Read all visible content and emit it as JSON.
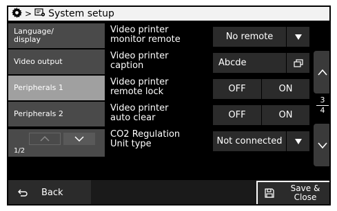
{
  "titlebar": {
    "gear_icon": "gear-icon",
    "separator": ">",
    "crumb_icon": "system-setup-icon",
    "title": "System setup"
  },
  "sidebar": {
    "items": [
      {
        "label": "Language/ display",
        "active": false
      },
      {
        "label": "Video output",
        "active": false
      },
      {
        "label": "Peripherals 1",
        "active": true
      },
      {
        "label": "Peripherals 2",
        "active": false
      }
    ],
    "pager": {
      "page": "1/2"
    }
  },
  "rows": [
    {
      "label_1": "Video printer",
      "label_2": "monitor remote",
      "type": "dropdown",
      "value": "No remote"
    },
    {
      "label_1": "Video printer",
      "label_2": "caption",
      "type": "text",
      "value": "Abcde",
      "icon": "window-icon"
    },
    {
      "label_1": "Video printer",
      "label_2": "remote lock",
      "type": "toggle",
      "off": "OFF",
      "on": "ON"
    },
    {
      "label_1": "Video printer",
      "label_2": "auto clear",
      "type": "toggle",
      "off": "OFF",
      "on": "ON"
    },
    {
      "label_1": "CO2 Regulation",
      "label_2": "Unit type",
      "type": "dropdown",
      "value": "Not connected"
    }
  ],
  "scroller": {
    "current": "3",
    "total": "4"
  },
  "bottombar": {
    "back_label": "Back",
    "save_label_1": "Save &",
    "save_label_2": "Close"
  },
  "colors": {
    "background": "#000000",
    "active": "#a0a0a0",
    "button": "#2b2b2b",
    "titlebar": "#f2f2f2"
  }
}
